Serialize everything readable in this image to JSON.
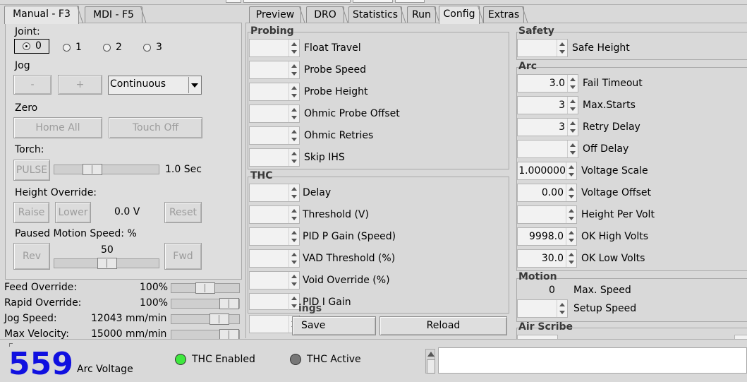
{
  "tabs_left": [
    {
      "label": "Manual - F3",
      "active": true
    },
    {
      "label": "MDI - F5",
      "active": false
    }
  ],
  "tabs_right": [
    {
      "label": "Preview",
      "active": false
    },
    {
      "label": "DRO",
      "active": false
    },
    {
      "label": "Statistics",
      "active": false
    },
    {
      "label": "Run",
      "active": false
    },
    {
      "label": "Config",
      "active": true
    },
    {
      "label": "Extras",
      "active": false
    }
  ],
  "manual": {
    "joint_label": "Joint:",
    "joints": [
      "0",
      "1",
      "2",
      "3"
    ],
    "selected_joint": "0",
    "jog_label": "Jog",
    "jog_minus": "-",
    "jog_plus": "+",
    "jog_mode": "Continuous",
    "zero_label": "Zero",
    "home_all": "Home All",
    "touch_off": "Touch Off",
    "torch_label": "Torch:",
    "pulse": "PULSE",
    "torch_value": "1.0 Sec",
    "height_override_label": "Height Override:",
    "raise": "Raise",
    "lower": "Lower",
    "height_value": "0.0 V",
    "reset": "Reset",
    "paused_motion_label": "Paused Motion Speed: %",
    "rev": "Rev",
    "paused_value": "50",
    "fwd": "Fwd"
  },
  "overrides": [
    {
      "label": "Feed Override:",
      "value": "100%",
      "pct": 0.65
    },
    {
      "label": "Rapid Override:",
      "value": "100%",
      "pct": 1.0
    },
    {
      "label": "Jog Speed:",
      "value": "12043 mm/min",
      "pct": 0.82
    },
    {
      "label": "Max Velocity:",
      "value": "15000 mm/min",
      "pct": 1.0
    }
  ],
  "probing": {
    "title": "Probing",
    "fields": [
      {
        "label": "Float Travel",
        "value": ""
      },
      {
        "label": "Probe Speed",
        "value": ""
      },
      {
        "label": "Probe Height",
        "value": ""
      },
      {
        "label": "Ohmic Probe Offset",
        "value": ""
      },
      {
        "label": "Ohmic Retries",
        "value": ""
      },
      {
        "label": "Skip IHS",
        "value": ""
      }
    ]
  },
  "thc": {
    "title": "THC",
    "fields": [
      {
        "label": "Delay",
        "value": ""
      },
      {
        "label": "Threshold (V)",
        "value": ""
      },
      {
        "label": "PID P Gain (Speed)",
        "value": ""
      },
      {
        "label": "VAD Threshold (%)",
        "value": ""
      },
      {
        "label": "Void Override (%)",
        "value": ""
      },
      {
        "label": "PID I Gain",
        "value": ""
      }
    ]
  },
  "settings_partial": "ings",
  "save": "Save",
  "reload": "Reload",
  "safety": {
    "title": "Safety",
    "fields": [
      {
        "label": "Safe Height",
        "value": ""
      }
    ]
  },
  "arc": {
    "title": "Arc",
    "fields": [
      {
        "label": "Fail Timeout",
        "value": "3.0"
      },
      {
        "label": "Max.Starts",
        "value": "3"
      },
      {
        "label": "Retry Delay",
        "value": "3"
      },
      {
        "label": "Off Delay",
        "value": ""
      },
      {
        "label": "Voltage Scale",
        "value": "1.000000"
      },
      {
        "label": "Voltage Offset",
        "value": "0.00"
      },
      {
        "label": "Height Per Volt",
        "value": ""
      },
      {
        "label": "OK High Volts",
        "value": "9998.0"
      },
      {
        "label": "OK Low Volts",
        "value": "30.0"
      }
    ]
  },
  "motion": {
    "title": "Motion",
    "max_speed_value": "0",
    "max_speed_label": "Max. Speed",
    "setup_speed_label": "Setup Speed",
    "setup_speed_value": ""
  },
  "air_scribe": {
    "title": "Air Scribe"
  },
  "bottom": {
    "arc_voltage_value": "559",
    "arc_voltage_label": "Arc Voltage",
    "thc_enabled": "THC Enabled",
    "thc_active": "THC Active",
    "colors": {
      "enabled": "#3ee83e",
      "active": "#777777"
    }
  }
}
